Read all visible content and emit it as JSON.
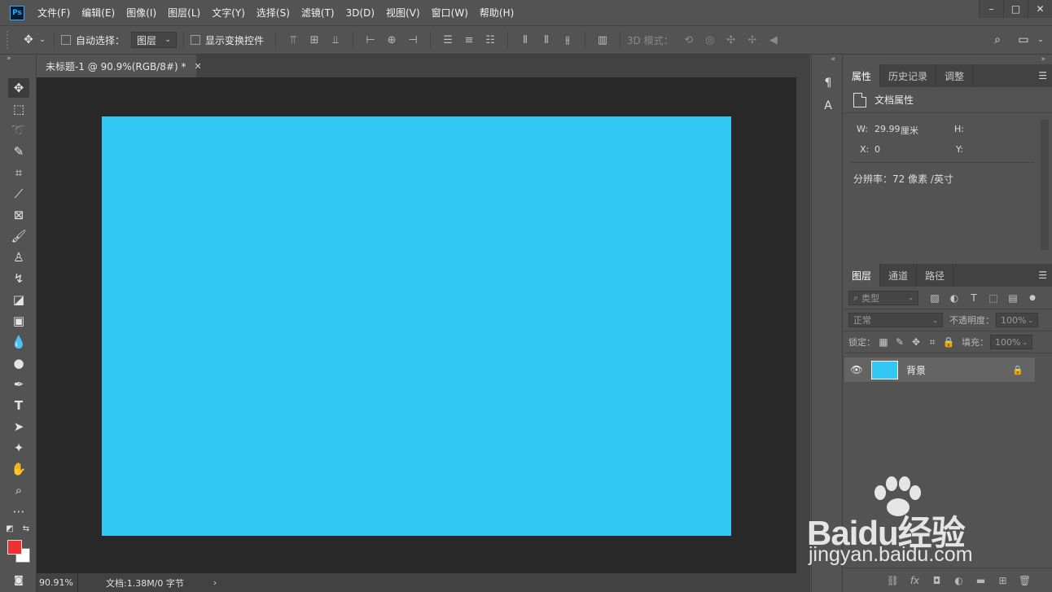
{
  "app": {
    "logo": "Ps"
  },
  "menu": [
    "文件(F)",
    "编辑(E)",
    "图像(I)",
    "图层(L)",
    "文字(Y)",
    "选择(S)",
    "滤镜(T)",
    "3D(D)",
    "视图(V)",
    "窗口(W)",
    "帮助(H)"
  ],
  "window_controls": {
    "minimize": "–",
    "maximize": "□",
    "close": "✕"
  },
  "options": {
    "auto_select_label": "自动选择：",
    "auto_select_target": "图层",
    "show_transform_label": "显示变换控件",
    "mode_3d_label": "3D 模式："
  },
  "document": {
    "tab_title": "未标题-1 @ 90.9%(RGB/8#) *",
    "canvas_color": "#33c7f3",
    "zoom": "90.91%",
    "doc_info": "文档:1.38M/0 字节"
  },
  "properties": {
    "tabs": [
      "属性",
      "历史记录",
      "调整"
    ],
    "title": "文档属性",
    "w_label": "W:",
    "w_value": "29.99",
    "w_unit": "厘米",
    "h_label": "H:",
    "x_label": "X:",
    "x_value": "0",
    "y_label": "Y:",
    "resolution": "分辨率：72 像素 /英寸"
  },
  "layers": {
    "tabs": [
      "图层",
      "通道",
      "路径"
    ],
    "filter_kind": "类型",
    "blend_mode": "正常",
    "opacity_label": "不透明度：",
    "opacity_value": "100%",
    "lock_label": "锁定：",
    "fill_label": "填充：",
    "fill_value": "100%",
    "items": [
      {
        "name": "背景",
        "locked": true,
        "visible": true
      }
    ]
  },
  "colors": {
    "foreground": "#ee3131",
    "background": "#ffffff"
  },
  "watermark": {
    "text": "Baidu经验",
    "url": "jingyan.baidu.com"
  }
}
